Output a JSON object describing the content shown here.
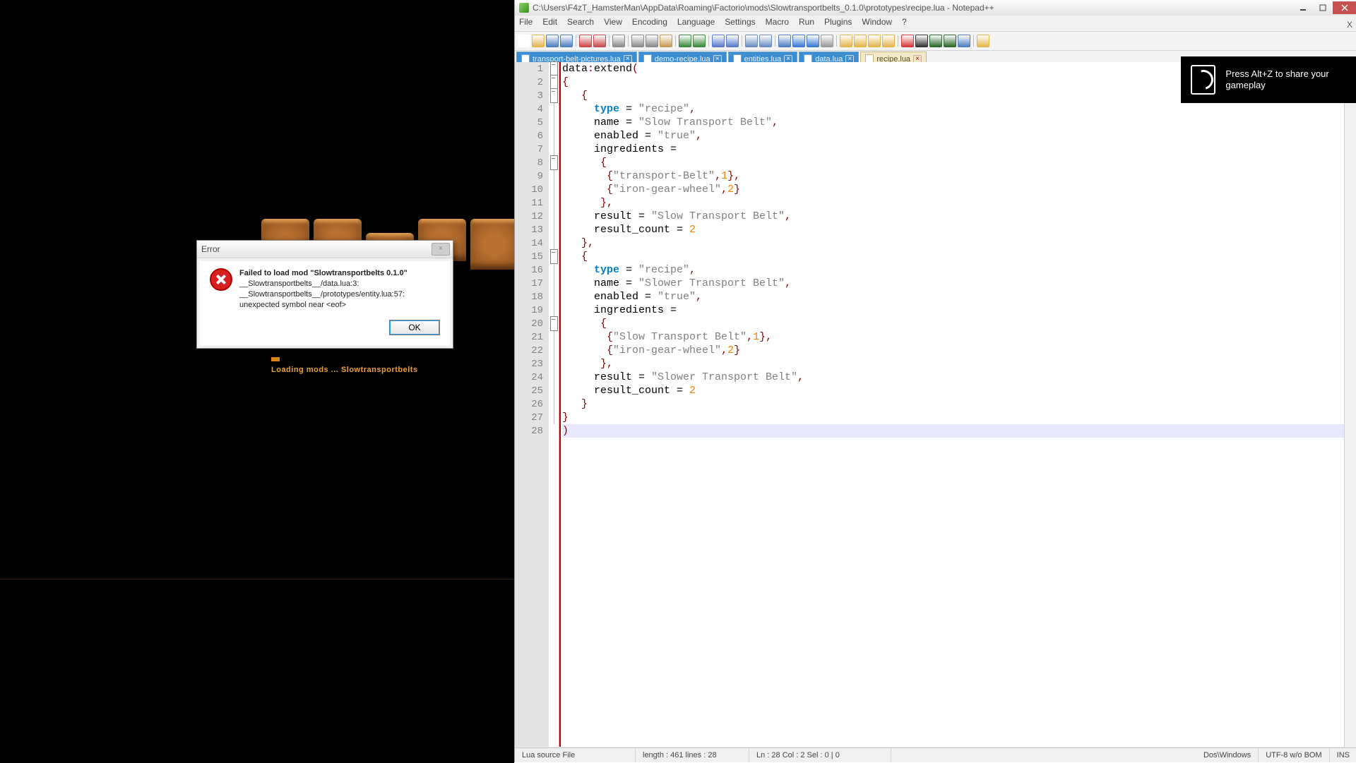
{
  "game": {
    "loading_text": "Loading mods ... Slowtransportbelts"
  },
  "error_dialog": {
    "title": "Error",
    "line1": "Failed to load mod \"Slowtransportbelts 0.1.0\"",
    "line2": "__Slowtransportbelts__/data.lua:3:",
    "line3": "__Slowtransportbelts__/prototypes/entity.lua:57: unexpected symbol near <eof>",
    "ok": "OK"
  },
  "nvidia": {
    "text": "Press Alt+Z to share your gameplay"
  },
  "editor": {
    "title_path": "C:\\Users\\F4zT_HamsterMan\\AppData\\Roaming\\Factorio\\mods\\Slowtransportbelts_0.1.0\\prototypes\\recipe.lua - Notepad++",
    "top_x": "X",
    "menu": [
      "File",
      "Edit",
      "Search",
      "View",
      "Encoding",
      "Language",
      "Settings",
      "Macro",
      "Run",
      "Plugins",
      "Window",
      "?"
    ],
    "tabs": [
      {
        "label": "transport-belt-pictures.lua",
        "active": false
      },
      {
        "label": "demo-recipe.lua",
        "active": false
      },
      {
        "label": "entities.lua",
        "active": false
      },
      {
        "label": "data.lua",
        "active": false
      },
      {
        "label": "recipe.lua",
        "active": true
      }
    ],
    "status": {
      "filetype": "Lua source File",
      "length": "length : 461    lines : 28",
      "pos": "Ln : 28    Col : 2    Sel : 0 | 0",
      "eol": "Dos\\Windows",
      "enc": "UTF-8 w/o BOM",
      "mode": "INS"
    },
    "code": [
      {
        "n": 1,
        "fold": "box",
        "tokens": [
          [
            "txt",
            "data"
          ],
          [
            "r",
            ":"
          ],
          [
            "txt",
            "extend"
          ],
          [
            "r",
            "("
          ]
        ]
      },
      {
        "n": 2,
        "fold": "box",
        "tokens": [
          [
            "r",
            "{"
          ]
        ]
      },
      {
        "n": 3,
        "fold": "box",
        "tokens": [
          [
            "txt",
            "   "
          ],
          [
            "r",
            "{"
          ]
        ]
      },
      {
        "n": 4,
        "fold": "line",
        "tokens": [
          [
            "txt",
            "     "
          ],
          [
            "k",
            "type"
          ],
          [
            "txt",
            " = "
          ],
          [
            "s",
            "\"recipe\""
          ],
          [
            "r",
            ","
          ]
        ]
      },
      {
        "n": 5,
        "fold": "line",
        "tokens": [
          [
            "txt",
            "     name = "
          ],
          [
            "s",
            "\"Slow Transport Belt\""
          ],
          [
            "r",
            ","
          ]
        ]
      },
      {
        "n": 6,
        "fold": "line",
        "tokens": [
          [
            "txt",
            "     enabled = "
          ],
          [
            "s",
            "\"true\""
          ],
          [
            "r",
            ","
          ]
        ]
      },
      {
        "n": 7,
        "fold": "line",
        "tokens": [
          [
            "txt",
            "     ingredients ="
          ]
        ]
      },
      {
        "n": 8,
        "fold": "box",
        "tokens": [
          [
            "txt",
            "      "
          ],
          [
            "r",
            "{"
          ]
        ]
      },
      {
        "n": 9,
        "fold": "line",
        "tokens": [
          [
            "txt",
            "       "
          ],
          [
            "r",
            "{"
          ],
          [
            "s",
            "\"transport-Belt\""
          ],
          [
            "r",
            ","
          ],
          [
            "n",
            "1"
          ],
          [
            "r",
            "},"
          ]
        ]
      },
      {
        "n": 10,
        "fold": "line",
        "tokens": [
          [
            "txt",
            "       "
          ],
          [
            "r",
            "{"
          ],
          [
            "s",
            "\"iron-gear-wheel\""
          ],
          [
            "r",
            ","
          ],
          [
            "n",
            "2"
          ],
          [
            "r",
            "}"
          ]
        ]
      },
      {
        "n": 11,
        "fold": "line",
        "tokens": [
          [
            "txt",
            "      "
          ],
          [
            "r",
            "},"
          ]
        ]
      },
      {
        "n": 12,
        "fold": "line",
        "tokens": [
          [
            "txt",
            "     result = "
          ],
          [
            "s",
            "\"Slow Transport Belt\""
          ],
          [
            "r",
            ","
          ]
        ]
      },
      {
        "n": 13,
        "fold": "line",
        "tokens": [
          [
            "txt",
            "     result_count = "
          ],
          [
            "n",
            "2"
          ]
        ]
      },
      {
        "n": 14,
        "fold": "line",
        "tokens": [
          [
            "txt",
            "   "
          ],
          [
            "r",
            "},"
          ]
        ]
      },
      {
        "n": 15,
        "fold": "box",
        "tokens": [
          [
            "txt",
            "   "
          ],
          [
            "r",
            "{"
          ]
        ]
      },
      {
        "n": 16,
        "fold": "line",
        "tokens": [
          [
            "txt",
            "     "
          ],
          [
            "k",
            "type"
          ],
          [
            "txt",
            " = "
          ],
          [
            "s",
            "\"recipe\""
          ],
          [
            "r",
            ","
          ]
        ]
      },
      {
        "n": 17,
        "fold": "line",
        "tokens": [
          [
            "txt",
            "     name = "
          ],
          [
            "s",
            "\"Slower Transport Belt\""
          ],
          [
            "r",
            ","
          ]
        ]
      },
      {
        "n": 18,
        "fold": "line",
        "tokens": [
          [
            "txt",
            "     enabled = "
          ],
          [
            "s",
            "\"true\""
          ],
          [
            "r",
            ","
          ]
        ]
      },
      {
        "n": 19,
        "fold": "line",
        "tokens": [
          [
            "txt",
            "     ingredients ="
          ]
        ]
      },
      {
        "n": 20,
        "fold": "box",
        "tokens": [
          [
            "txt",
            "      "
          ],
          [
            "r",
            "{"
          ]
        ]
      },
      {
        "n": 21,
        "fold": "line",
        "tokens": [
          [
            "txt",
            "       "
          ],
          [
            "r",
            "{"
          ],
          [
            "s",
            "\"Slow Transport Belt\""
          ],
          [
            "r",
            ","
          ],
          [
            "n",
            "1"
          ],
          [
            "r",
            "},"
          ]
        ]
      },
      {
        "n": 22,
        "fold": "line",
        "tokens": [
          [
            "txt",
            "       "
          ],
          [
            "r",
            "{"
          ],
          [
            "s",
            "\"iron-gear-wheel\""
          ],
          [
            "r",
            ","
          ],
          [
            "n",
            "2"
          ],
          [
            "r",
            "}"
          ]
        ]
      },
      {
        "n": 23,
        "fold": "line",
        "tokens": [
          [
            "txt",
            "      "
          ],
          [
            "r",
            "},"
          ]
        ]
      },
      {
        "n": 24,
        "fold": "line",
        "tokens": [
          [
            "txt",
            "     result = "
          ],
          [
            "s",
            "\"Slower Transport Belt\""
          ],
          [
            "r",
            ","
          ]
        ]
      },
      {
        "n": 25,
        "fold": "line",
        "tokens": [
          [
            "txt",
            "     result_count = "
          ],
          [
            "n",
            "2"
          ]
        ]
      },
      {
        "n": 26,
        "fold": "line",
        "tokens": [
          [
            "txt",
            "   "
          ],
          [
            "r",
            "}"
          ]
        ]
      },
      {
        "n": 27,
        "fold": "line",
        "tokens": [
          [
            "r",
            "}"
          ]
        ]
      },
      {
        "n": 28,
        "fold": "",
        "sel": true,
        "tokens": [
          [
            "r",
            ")"
          ]
        ]
      }
    ],
    "toolbar_icons": [
      "new",
      "open",
      "save",
      "save-all",
      "sep",
      "close",
      "close-all",
      "sep",
      "print",
      "sep",
      "cut",
      "copy",
      "paste",
      "sep",
      "undo",
      "redo",
      "sep",
      "find",
      "replace",
      "sep",
      "zoom-in",
      "zoom-out",
      "sep",
      "sync",
      "wrap",
      "allchars",
      "indent",
      "sep",
      "folder",
      "fold",
      "unfold",
      "hidden",
      "sep",
      "rec",
      "stop",
      "play",
      "play-multi",
      "rec-save",
      "sep",
      "spell"
    ],
    "toolbar_colors": {
      "new": "#fff",
      "open": "#e2b64c",
      "save": "#4d7dc1",
      "save-all": "#4d7dc1",
      "close": "#c94a4a",
      "close-all": "#c94a4a",
      "print": "#8a8a8a",
      "cut": "#8a8a8a",
      "copy": "#8a8a8a",
      "paste": "#c49a52",
      "undo": "#3a8a3a",
      "redo": "#3a8a3a",
      "find": "#5a7acb",
      "replace": "#5a7acb",
      "zoom-in": "#6a8ec2",
      "zoom-out": "#6a8ec2",
      "sync": "#4d7dc1",
      "wrap": "#3a7ad1",
      "allchars": "#3a7ad1",
      "indent": "#999",
      "folder": "#e2b64c",
      "fold": "#e2b64c",
      "unfold": "#e2b64c",
      "hidden": "#e2b64c",
      "rec": "#d43a3a",
      "stop": "#333",
      "play": "#2a6a2a",
      "play-multi": "#2a6a2a",
      "rec-save": "#4d7dc1",
      "spell": "#e2b64c"
    }
  }
}
